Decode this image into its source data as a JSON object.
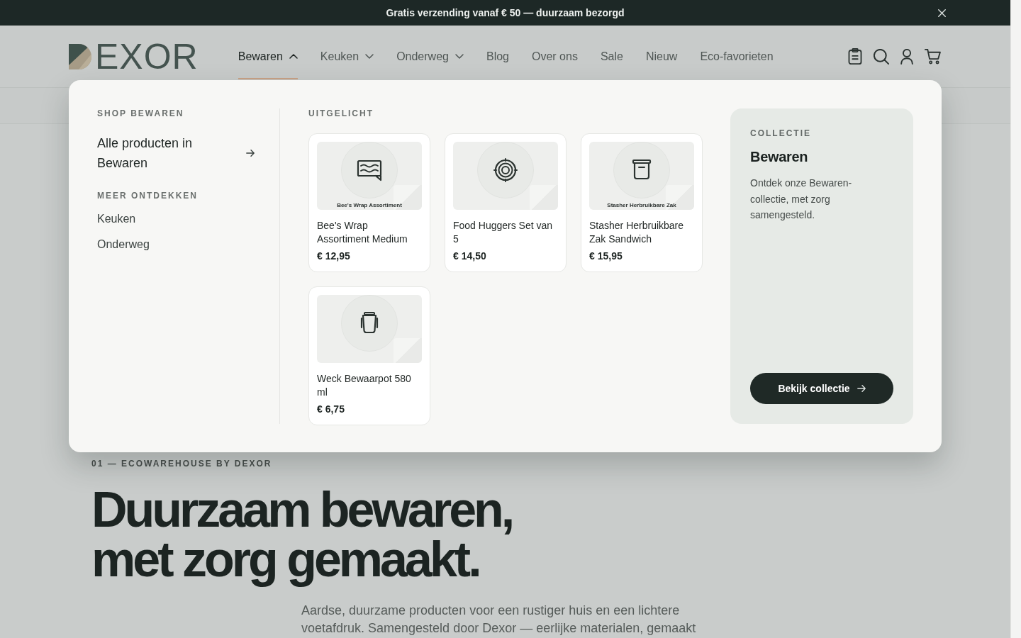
{
  "announcement": {
    "text": "Gratis verzending vanaf € 50 — duurzaam bezorgd"
  },
  "header": {
    "logo": {
      "text": "EXOR"
    },
    "nav": [
      {
        "label": "Bewaren",
        "kind": "dropdown",
        "expanded": true,
        "selected": true
      },
      {
        "label": "Keuken",
        "kind": "dropdown",
        "expanded": false,
        "selected": false
      },
      {
        "label": "Onderweg",
        "kind": "dropdown",
        "expanded": false,
        "selected": false
      },
      {
        "label": "Blog",
        "kind": "link",
        "selected": false
      },
      {
        "label": "Over ons",
        "kind": "link",
        "selected": false
      },
      {
        "label": "Sale",
        "kind": "link",
        "selected": false
      },
      {
        "label": "Nieuw",
        "kind": "link",
        "selected": false
      },
      {
        "label": "Eco-favorieten",
        "kind": "link",
        "selected": false
      }
    ]
  },
  "mega_menu": {
    "shop": {
      "heading": "SHOP BEWAREN",
      "all_link": "Alle producten in Bewaren",
      "more_heading": "MEER ONTDEKKEN",
      "more_links": [
        "Keuken",
        "Onderweg"
      ]
    },
    "featured": {
      "heading": "UITGELICHT",
      "products": [
        {
          "kind": "wrap",
          "image_caption": "Bee's Wrap Assortiment",
          "name": "Bee's Wrap Assortiment Medium",
          "price": "€ 12,95"
        },
        {
          "kind": "rings",
          "name": "Food Huggers Set van 5",
          "price": "€ 14,50"
        },
        {
          "kind": "bin",
          "image_caption": "Stasher Herbruikbare Zak",
          "name": "Stasher Herbruikbare Zak Sandwich",
          "price": "€ 15,95"
        },
        {
          "kind": "jar",
          "name": "Weck Bewaarpot 580 ml",
          "price": "€ 6,75"
        }
      ]
    },
    "collection": {
      "eyebrow": "COLLECTIE",
      "title": "Bewaren",
      "description": "Ontdek onze Bewaren-collectie, met zorg samengesteld.",
      "button": "Bekijk collectie"
    }
  },
  "hero": {
    "eyebrow": "01 — ECOWAREHOUSE BY DEXOR",
    "headline_lines": [
      "Duurzaam bewaren,",
      "met zorg gemaakt."
    ],
    "intro_lines": [
      "Aardse, duurzame producten voor een rustiger huis en een lichtere",
      "voetafdruk. Samengesteld door Dexor — eerlijke materialen, gemaakt"
    ]
  }
}
